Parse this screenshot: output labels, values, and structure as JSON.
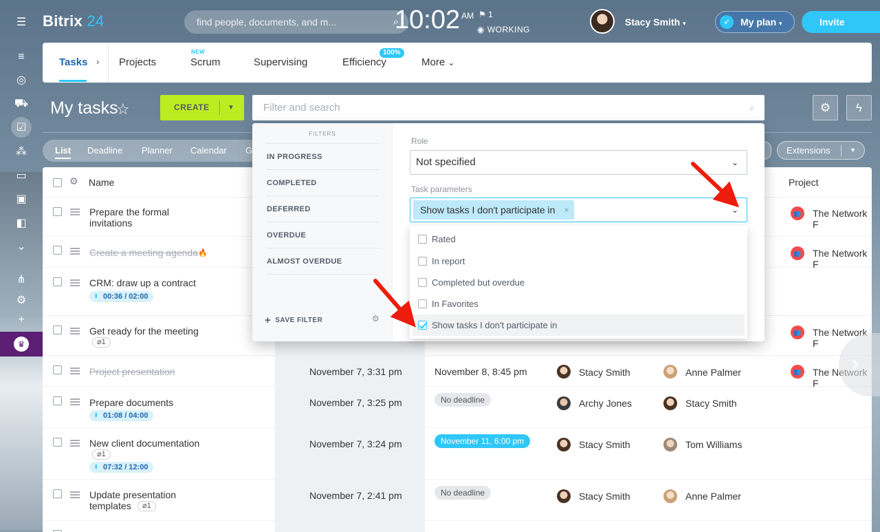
{
  "app": {
    "brand": "Bitrix",
    "brand_num": "24"
  },
  "header": {
    "search_placeholder": "find people, documents, and m...",
    "clock": "10:02",
    "ampm": "AM",
    "flag_count": "1",
    "work_status": "WORKING",
    "user_name": "Stacy Smith",
    "my_plan": "My plan",
    "invite": "Invite"
  },
  "tabs": {
    "tasks": "Tasks",
    "projects": "Projects",
    "scrum": "Scrum",
    "scrum_badge": "NEW",
    "supervising": "Supervising",
    "efficiency": "Efficiency",
    "efficiency_badge": "100%",
    "more": "More"
  },
  "page": {
    "title": "My tasks",
    "create": "CREATE",
    "filter_placeholder": "Filter and search",
    "extensions": "Extensions"
  },
  "views": [
    "List",
    "Deadline",
    "Planner",
    "Calendar",
    "G"
  ],
  "grid": {
    "col_name": "Name",
    "col_project": "Project",
    "rows": [
      {
        "name": "Prepare the formal",
        "name2": "invitations",
        "project": "The Network F"
      },
      {
        "name": "Create a meeting agenda",
        "project": "The Network F",
        "done": true
      },
      {
        "name": "CRM: draw up a contract",
        "timer": "00:36 / 02:00"
      },
      {
        "name": "Get ready for the meeting",
        "clip": "1",
        "project": "The Network F"
      },
      {
        "name": "Project presentation",
        "created": "November 7, 3:31 pm",
        "deadline": "November 8, 8:45 pm",
        "responsible": "Stacy Smith",
        "creator": "Anne Palmer",
        "project": "The Network F",
        "done": true
      },
      {
        "name": "Prepare documents",
        "timer": "01:08 / 04:00",
        "created": "November 7, 3:25 pm",
        "deadline": "No deadline",
        "responsible": "Archy Jones",
        "creator": "Stacy Smith"
      },
      {
        "name": "New client documentation",
        "clip": "1",
        "timer": "07:32 / 12:00",
        "created": "November 7, 3:24 pm",
        "deadline": "November 11, 6:00 pm",
        "responsible": "Stacy Smith",
        "creator": "Tom Williams"
      },
      {
        "name": "Update presentation",
        "name2": "templates",
        "clip": "1",
        "created": "November 7, 2:41 pm",
        "deadline": "No deadline",
        "responsible": "Stacy Smith",
        "creator": "Anne Palmer"
      }
    ]
  },
  "filter": {
    "caption": "FILTERS",
    "presets": [
      "IN PROGRESS",
      "COMPLETED",
      "DEFERRED",
      "OVERDUE",
      "ALMOST OVERDUE"
    ],
    "save_filter": "SAVE FILTER",
    "role_label": "Role",
    "role_value": "Not specified",
    "params_label": "Task parameters",
    "params_tag": "Show tasks I don't participate in",
    "options": [
      {
        "label": "Rated",
        "checked": false
      },
      {
        "label": "In report",
        "checked": false
      },
      {
        "label": "Completed but overdue",
        "checked": false
      },
      {
        "label": "In Favorites",
        "checked": false
      },
      {
        "label": "Show tasks I don't participate in",
        "checked": true
      }
    ]
  },
  "colors": {
    "accent": "#2fc7f7",
    "create": "#bbed21",
    "annotation": "#ee1c0c"
  }
}
